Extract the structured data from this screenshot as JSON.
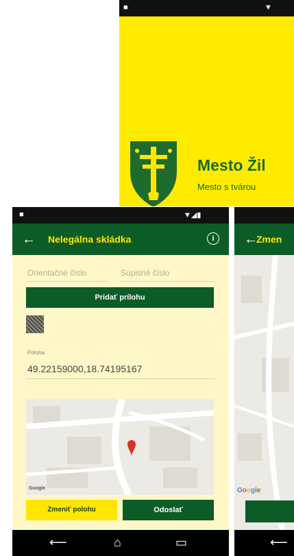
{
  "splash": {
    "title": "Mesto Žil",
    "subtitle": "Mesto s tvárou"
  },
  "left_screen": {
    "title": "Nelegálna skládka",
    "fields": {
      "orientacne_placeholder": "Orientačné číslo",
      "supisne_placeholder": "Súpisné číslo"
    },
    "add_attachment_label": "Pridať prílohu",
    "poloha_label": "Poloha",
    "poloha_value": "49.22159000,18.74195167",
    "map_pin_label": "Mapa",
    "change_location_label": "Zmeniť polohu",
    "send_label": "Odoslať"
  },
  "right_screen": {
    "title": "Zmen",
    "google_label": "Google"
  },
  "colors": {
    "accent_green": "#0c5c27",
    "accent_yellow": "#ffe600",
    "background_cream": "#fff7c8"
  }
}
